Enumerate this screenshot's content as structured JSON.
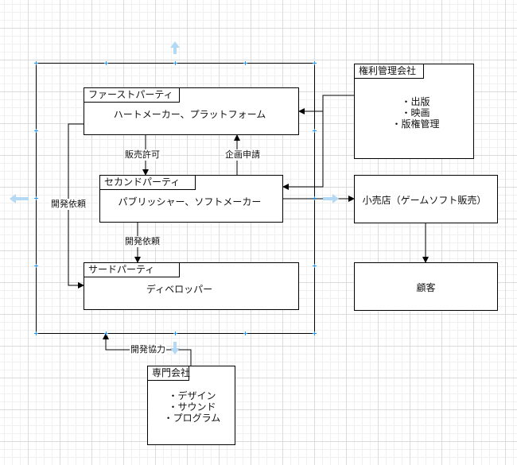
{
  "nodes": {
    "first_party": {
      "header": "ファーストパーティ",
      "body": "ハートメーカー、プラットフォーム"
    },
    "second_party": {
      "header": "セカンドパーティ",
      "body": "パブリッシャー、ソフトメーカー"
    },
    "third_party": {
      "header": "サードパーティ",
      "body": "ディベロッパー"
    },
    "rights_company": {
      "header": "権利管理会社",
      "items": [
        "・出版",
        "・映画",
        "・版権管理"
      ]
    },
    "retailer": {
      "body": "小売店（ゲームソフト販売）"
    },
    "customer": {
      "body": "顧客"
    },
    "specialist": {
      "header": "専門会社",
      "items": [
        "・デザイン",
        "・サウンド",
        "・プログラム"
      ]
    }
  },
  "edge_labels": {
    "sales_permission": "販売許可",
    "planning_application": "企画申請",
    "dev_request_left": "開発依頼",
    "dev_request_mid": "開発依頼",
    "dev_cooperation": "開発協力"
  }
}
